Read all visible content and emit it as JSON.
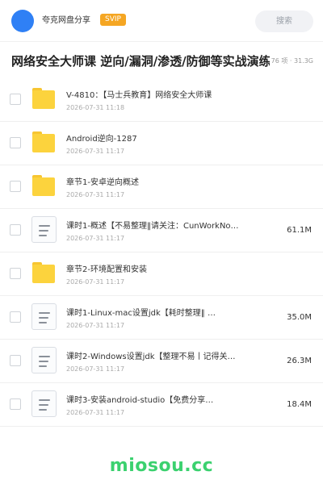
{
  "header": {
    "user_name": "夸克网盘分享",
    "badge": "SVIP",
    "search_label": "搜索"
  },
  "share": {
    "title": "网络安全大师课 逆向/漏洞/渗透/防御等实战演练",
    "meta": "76 项 · 31.3G"
  },
  "files": [
    {
      "type": "folder",
      "name": "V-4810：【马士兵教育】网络安全大师课",
      "date": "2026-07-31 11:18",
      "size": ""
    },
    {
      "type": "folder",
      "name": "Android逆向-1287",
      "date": "2026-07-31 11:17",
      "size": ""
    },
    {
      "type": "folder",
      "name": "章节1-安卓逆向概述",
      "date": "2026-07-31 11:17",
      "size": ""
    },
    {
      "type": "file",
      "name": "课时1-概述【不易整理‖请关注：CunWorkNo…",
      "date": "2026-07-31 11:17",
      "size": "61.1M"
    },
    {
      "type": "folder",
      "name": "章节2-环境配置和安装",
      "date": "2026-07-31 11:17",
      "size": ""
    },
    {
      "type": "file",
      "name": "课时1-Linux-mac设置jdk【耗时整理‖ …",
      "date": "2026-07-31 11:17",
      "size": "35.0M"
    },
    {
      "type": "file",
      "name": "课时2-Windows设置jdk【整理不易丨记得关…",
      "date": "2026-07-31 11:17",
      "size": "26.3M"
    },
    {
      "type": "file",
      "name": "课时3-安装android-studio【免费分享…",
      "date": "2026-07-31 11:17",
      "size": "18.4M"
    }
  ],
  "watermark": "miosou.cc",
  "icons": {
    "folder": "folder-icon",
    "file": "document-icon"
  },
  "colors": {
    "avatar": "#2f80f5",
    "svip_badge": "#f5a623",
    "folder": "#fcd33d",
    "watermark": "#3bd16f"
  }
}
